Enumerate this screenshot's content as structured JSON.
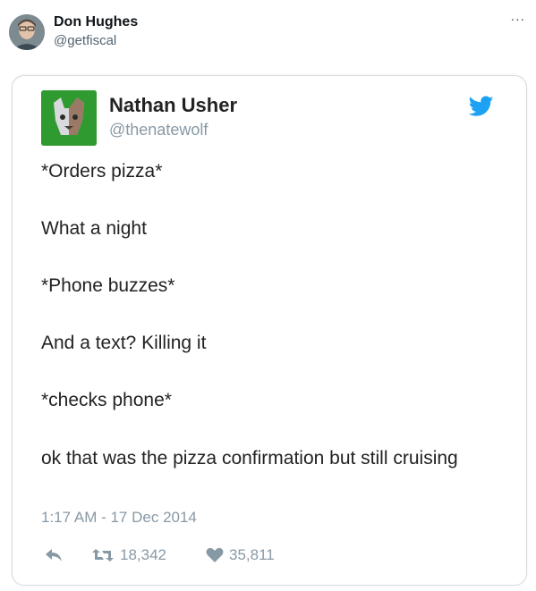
{
  "outer": {
    "name": "Don Hughes",
    "handle": "@getfiscal",
    "more": "..."
  },
  "embedded": {
    "name": "Nathan Usher",
    "handle": "@thenatewolf",
    "lines": [
      "*Orders pizza*",
      "What a night",
      "*Phone buzzes*",
      "And a text? Killing it",
      "*checks phone*",
      "ok that was the pizza confirmation but still cruising"
    ],
    "timestamp": "1:17 AM - 17 Dec 2014",
    "retweets": "18,342",
    "likes": "35,811"
  },
  "colors": {
    "twitter_blue": "#1da1f2",
    "avatar_green": "#2f9a2f",
    "muted_text": "#8899a6"
  },
  "icons": [
    "more-icon",
    "twitter-bird-icon",
    "reply-icon",
    "retweet-icon",
    "heart-icon"
  ]
}
